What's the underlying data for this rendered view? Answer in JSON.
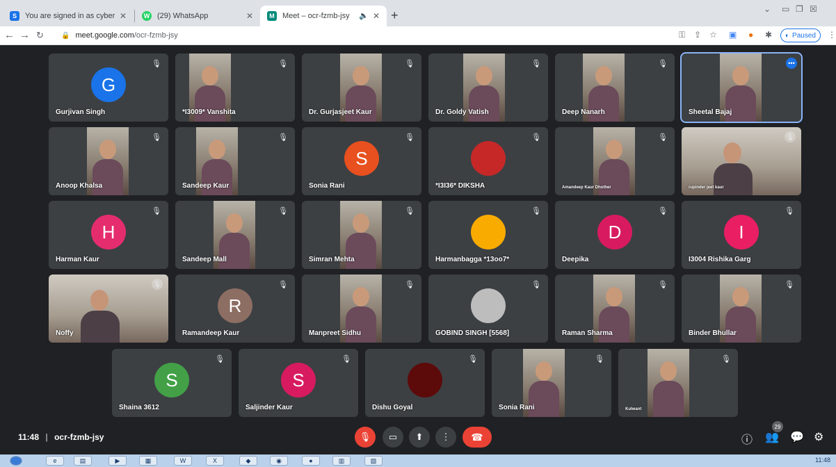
{
  "browser": {
    "tabs": [
      {
        "title": "You are signed in as cyber",
        "favicon": "S",
        "favicon_color": "#1a73e8"
      },
      {
        "title": "(29) WhatsApp",
        "favicon": "W",
        "favicon_color": "#25d366"
      },
      {
        "title": "Meet – ocr-fzmb-jsy",
        "favicon": "M",
        "favicon_color": "#00897b",
        "active": true,
        "audio_icon": "speaker-icon"
      }
    ],
    "new_tab": "+",
    "url_host": "meet.google.com",
    "url_path": "/ocr-fzmb-jsy",
    "profile_status": "Paused"
  },
  "participants": [
    {
      "name": "Gurjivan Singh",
      "type": "avatar",
      "initial": "G",
      "color": "#1a73e8"
    },
    {
      "name": "*I3009* Vanshita",
      "type": "video"
    },
    {
      "name": "Dr. Gurjasjeet Kaur",
      "type": "video"
    },
    {
      "name": "Dr. Goldy Vatish",
      "type": "video"
    },
    {
      "name": "Deep Nanarh",
      "type": "video"
    },
    {
      "name": "Sheetal Bajaj",
      "type": "video",
      "selected": true
    },
    {
      "name": "Anoop Khalsa",
      "type": "video"
    },
    {
      "name": "Sandeep Kaur",
      "type": "video"
    },
    {
      "name": "Sonia Rani",
      "type": "avatar",
      "initial": "S",
      "color": "#e8501f"
    },
    {
      "name": "*I3I36* DIKSHA",
      "type": "logo",
      "color": "#c62828"
    },
    {
      "name": "Amandeep Kaur Dhother",
      "type": "video",
      "small": true
    },
    {
      "name": "rupinder jeet kaur",
      "type": "widevideo",
      "small": true
    },
    {
      "name": "Harman Kaur",
      "type": "avatar",
      "initial": "H",
      "color": "#e52d6e"
    },
    {
      "name": "Sandeep Mall",
      "type": "video"
    },
    {
      "name": "Simran Mehta",
      "type": "video"
    },
    {
      "name": "Harmanbagga *13oo7*",
      "type": "logo",
      "color": "#f9ab00"
    },
    {
      "name": "Deepika",
      "type": "avatar",
      "initial": "D",
      "color": "#d81b60"
    },
    {
      "name": "I3004 Rishika Garg",
      "type": "avatar",
      "initial": "I",
      "color": "#e91e63"
    },
    {
      "name": "Noffy",
      "type": "widevideo"
    },
    {
      "name": "Ramandeep Kaur",
      "type": "avatar",
      "initial": "R",
      "color": "#8d6e63"
    },
    {
      "name": "Manpreet Sidhu",
      "type": "video"
    },
    {
      "name": "GOBIND SINGH [5568]",
      "type": "logo",
      "color": "#bdbdbd"
    },
    {
      "name": "Raman Sharma",
      "type": "video"
    },
    {
      "name": "Binder Bhullar",
      "type": "video"
    },
    {
      "name": "Shaina 3612",
      "type": "avatar",
      "initial": "S",
      "color": "#43a047"
    },
    {
      "name": "Saljinder Kaur",
      "type": "avatar",
      "initial": "S",
      "color": "#d81b60"
    },
    {
      "name": "Dishu Goyal",
      "type": "logo",
      "color": "#5d0a0a"
    },
    {
      "name": "Sonia Rani",
      "type": "video"
    },
    {
      "name": "Kulwant",
      "type": "video",
      "small": true
    }
  ],
  "bottom": {
    "time": "11:48",
    "separator": "|",
    "meeting_code": "ocr-fzmb-jsy",
    "participant_count": "29"
  },
  "taskbar": {
    "clock": "11:48"
  }
}
